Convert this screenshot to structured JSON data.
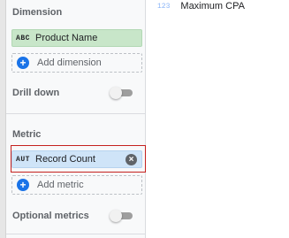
{
  "dimension_section": {
    "title": "Dimension",
    "chip": {
      "type": "ABC",
      "label": "Product Name"
    },
    "add_label": "Add dimension"
  },
  "drill_down": {
    "label": "Drill down",
    "enabled": false
  },
  "metric_section": {
    "title": "Metric",
    "chip": {
      "type": "AUT",
      "label": "Record Count"
    },
    "add_label": "Add metric"
  },
  "optional_metrics": {
    "label": "Optional metrics",
    "enabled": false
  },
  "field_list": [
    {
      "type": "123",
      "name": "Maximum CPA"
    }
  ],
  "icons": {
    "add": "add-circle-icon",
    "remove": "remove-circle-icon"
  },
  "colors": {
    "dimension_chip": "#c8e6c9",
    "metric_chip": "#cfe4f8",
    "accent": "#1a73e8",
    "selected_outline": "#c5221f"
  }
}
